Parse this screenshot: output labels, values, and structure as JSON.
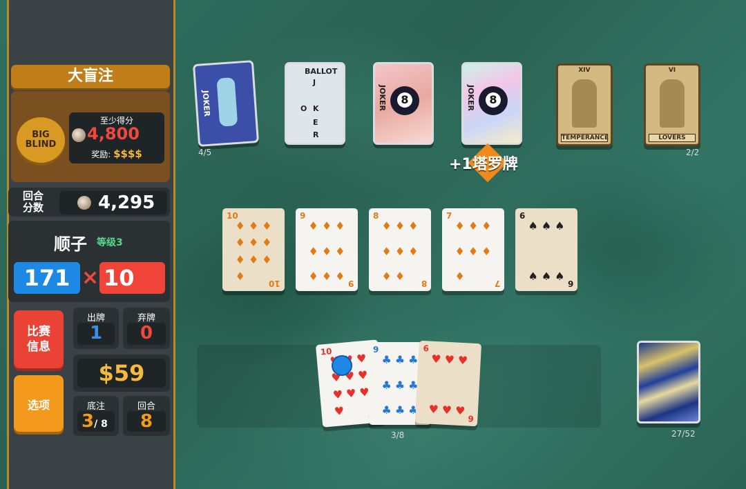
{
  "blind": {
    "title": "大盲注",
    "chip_label": "BIG BLIND",
    "target_label": "至少得分",
    "target_score": "4,800",
    "reward_label": "奖励:",
    "reward_value": "$$$$"
  },
  "round": {
    "label": "回合\n分数",
    "score": "4,295"
  },
  "hand": {
    "name": "顺子",
    "level": "等级3",
    "chips": "171",
    "times": "×",
    "mult": "10"
  },
  "buttons": {
    "run_info": "比赛\n信息",
    "options": "选项"
  },
  "stats": {
    "hands_label": "出牌",
    "hands_value": "1",
    "discards_label": "弃牌",
    "discards_value": "0",
    "money": "$59",
    "ante_label": "底注",
    "ante_value": "3",
    "ante_max": "/ 8",
    "round_label": "回合",
    "round_value": "8"
  },
  "jokers": {
    "count": "4/5",
    "items": [
      {
        "name": "JOKER",
        "mark": "JOKER"
      },
      {
        "name": "BALLOT",
        "letters": [
          "J",
          "O",
          "K",
          "E",
          "R"
        ]
      },
      {
        "name": "JOKER",
        "ball": "8"
      },
      {
        "name": "JOKER",
        "ball": "8"
      }
    ]
  },
  "consumables": {
    "count": "2/2",
    "items": [
      {
        "numeral": "XIV",
        "name": "TEMPERANCE"
      },
      {
        "numeral": "VI",
        "name": "LOVERS"
      }
    ]
  },
  "popup": "+1塔罗牌",
  "played_cards": [
    {
      "rank": "10",
      "suit": "♦",
      "color": "d",
      "worn": true
    },
    {
      "rank": "9",
      "suit": "♦",
      "color": "d",
      "worn": false
    },
    {
      "rank": "8",
      "suit": "♦",
      "color": "d",
      "worn": false
    },
    {
      "rank": "7",
      "suit": "♦",
      "color": "d",
      "worn": false
    },
    {
      "rank": "6",
      "suit": "♠",
      "color": "s",
      "worn": true
    }
  ],
  "hand_cards": [
    {
      "rank": "10",
      "suit": "♥",
      "color": "h",
      "worn": false
    },
    {
      "rank": "9",
      "suit": "♣",
      "color": "c",
      "worn": false
    },
    {
      "rank": "6",
      "suit": "♥",
      "color": "h",
      "worn": true
    }
  ],
  "hand_count": "3/8",
  "deck_count": "27/52"
}
